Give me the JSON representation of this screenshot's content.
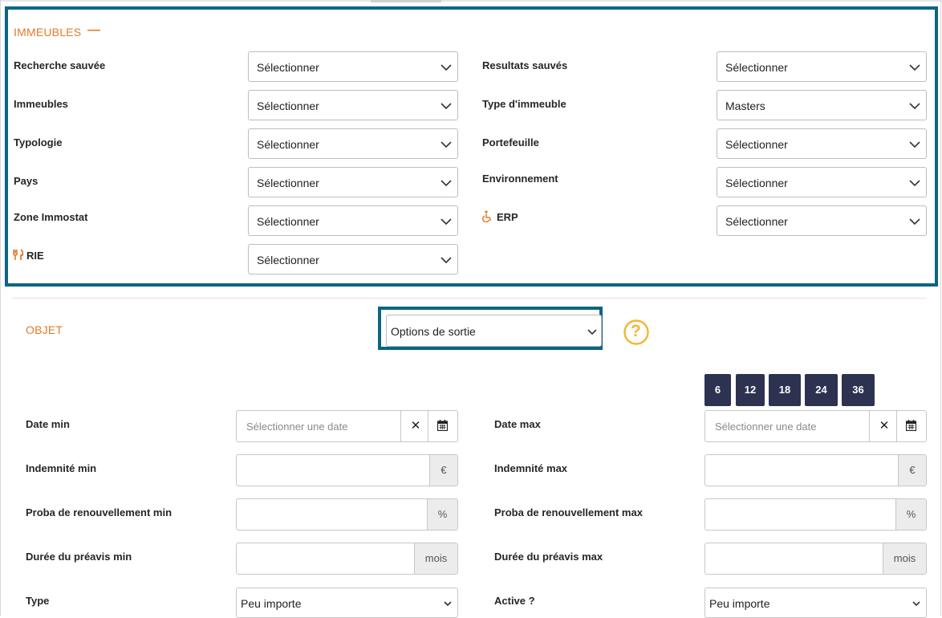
{
  "immeubles": {
    "title": "IMMEUBLES",
    "collapse_glyph": "—",
    "left": [
      {
        "label": "Recherche sauvée",
        "value": "Sélectionner"
      },
      {
        "label": "Immeubles",
        "value": "Sélectionner"
      },
      {
        "label": "Typologie",
        "value": "Sélectionner"
      },
      {
        "label": "Pays",
        "value": "Sélectionner"
      },
      {
        "label": "Zone Immostat",
        "value": "Sélectionner"
      },
      {
        "label": "RIE",
        "value": "Sélectionner",
        "icon": "fork-knife-icon"
      }
    ],
    "right": [
      {
        "label": "Resultats sauvés",
        "value": "Sélectionner"
      },
      {
        "label": "Type d'immeuble",
        "value": "Masters"
      },
      {
        "label": "Portefeuille",
        "value": "Sélectionner"
      },
      {
        "label": "Environnement",
        "value": "Sélectionner"
      },
      {
        "label": "ERP",
        "value": "Sélectionner",
        "icon": "wheelchair-icon"
      }
    ]
  },
  "objet": {
    "title": "OBJET",
    "options_select": "Options de sortie",
    "help_glyph": "?",
    "months": [
      "6",
      "12",
      "18",
      "24",
      "36"
    ],
    "date_min": {
      "label": "Date min",
      "placeholder": "Sélectionner une date",
      "clear": "✕"
    },
    "date_max": {
      "label": "Date max",
      "placeholder": "Sélectionner une date",
      "clear": "✕"
    },
    "indemnite_min": {
      "label": "Indemnité min",
      "addon": "€"
    },
    "indemnite_max": {
      "label": "Indemnité max",
      "addon": "€"
    },
    "proba_min": {
      "label": "Proba de renouvellement min",
      "addon": "%"
    },
    "proba_max": {
      "label": "Proba de renouvellement max",
      "addon": "%"
    },
    "preavis_min": {
      "label": "Durée du préavis min",
      "addon": "mois"
    },
    "preavis_max": {
      "label": "Durée du préavis max",
      "addon": "mois"
    },
    "type": {
      "label": "Type",
      "value": "Peu importe"
    },
    "active": {
      "label": "Active ?",
      "value": "Peu importe"
    }
  },
  "colors": {
    "accent_orange": "#e17b2a",
    "highlight_border": "#0b6584",
    "month_button_bg": "#2d3250",
    "help_icon": "#f2b632"
  }
}
